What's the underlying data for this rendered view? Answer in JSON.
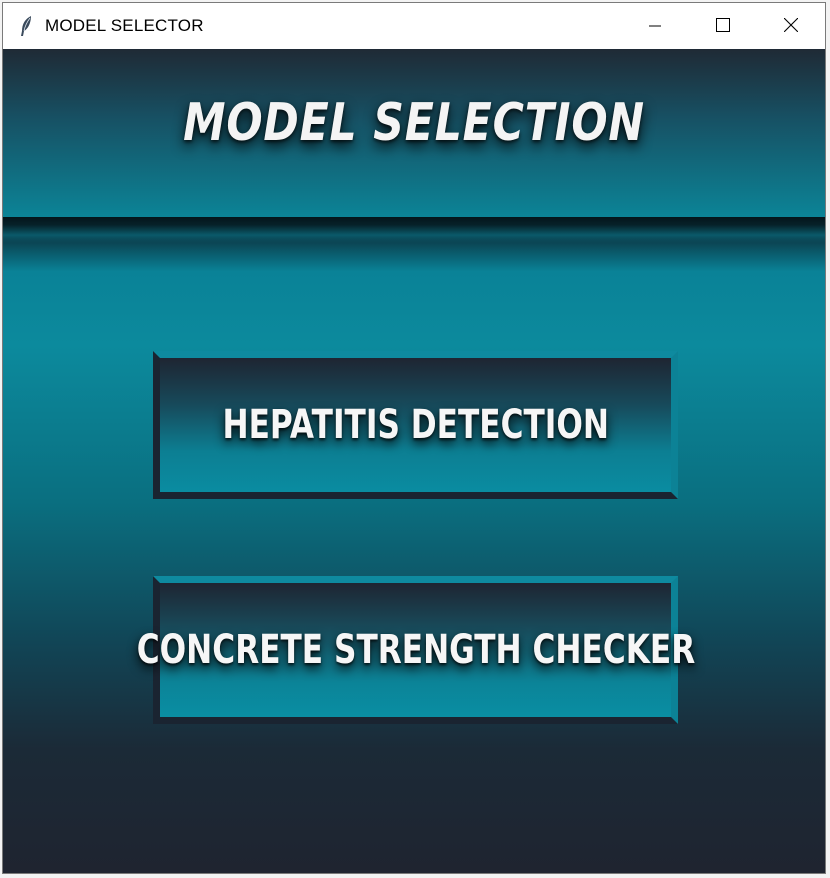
{
  "window": {
    "title": "MODEL SELECTOR",
    "app_icon": "feather-icon",
    "controls": {
      "minimize_icon": "minimize-icon",
      "maximize_icon": "maximize-icon",
      "close_icon": "close-icon"
    }
  },
  "main": {
    "heading": "MODEL SELECTION",
    "buttons": [
      {
        "label": "HEPATITIS DETECTION"
      },
      {
        "label": "CONCRETE STRENGTH CHECKER"
      }
    ]
  },
  "colors": {
    "accent_teal": "#0b8598",
    "dark_navy": "#1f2430",
    "text": "#f4f4f4"
  }
}
